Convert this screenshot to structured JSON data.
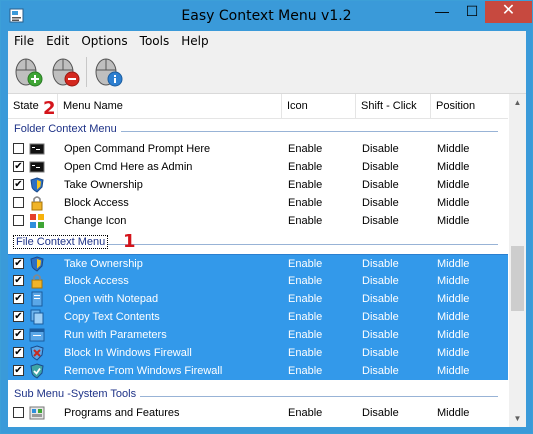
{
  "window": {
    "title": "Easy Context Menu v1.2",
    "minimize_glyph": "—",
    "maximize_glyph": "☐",
    "close_glyph": "✕",
    "accent_color": "#3a9ad9"
  },
  "menubar": {
    "items": [
      "File",
      "Edit",
      "Options",
      "Tools",
      "Help"
    ]
  },
  "toolbar": {
    "buttons": [
      {
        "icon": "mouse-add-icon"
      },
      {
        "icon": "mouse-remove-icon"
      },
      {
        "icon": "mouse-info-icon"
      }
    ]
  },
  "columns": {
    "state": "State",
    "menu_name": "Menu Name",
    "icon": "Icon",
    "shift": "Shift - Click",
    "position": "Position"
  },
  "groups": {
    "folder": "Folder Context Menu",
    "file": "File Context Menu",
    "submenu": "Sub Menu -System Tools"
  },
  "folder_rows": [
    {
      "checked": false,
      "icon": "console-icon",
      "name": "Open Command Prompt Here",
      "icon_state": "Enable",
      "shift": "Disable",
      "position": "Middle"
    },
    {
      "checked": true,
      "icon": "console-icon",
      "name": "Open Cmd Here as Admin",
      "icon_state": "Enable",
      "shift": "Disable",
      "position": "Middle"
    },
    {
      "checked": true,
      "icon": "shield-icon",
      "name": "Take Ownership",
      "icon_state": "Enable",
      "shift": "Disable",
      "position": "Middle"
    },
    {
      "checked": false,
      "icon": "lock-icon",
      "name": "Block Access",
      "icon_state": "Enable",
      "shift": "Disable",
      "position": "Middle"
    },
    {
      "checked": false,
      "icon": "change-icon-icon",
      "name": "Change Icon",
      "icon_state": "Enable",
      "shift": "Disable",
      "position": "Middle"
    }
  ],
  "file_rows": [
    {
      "checked": true,
      "icon": "shield-icon",
      "name": "Take Ownership",
      "icon_state": "Enable",
      "shift": "Disable",
      "position": "Middle"
    },
    {
      "checked": true,
      "icon": "lock-icon",
      "name": "Block Access",
      "icon_state": "Enable",
      "shift": "Disable",
      "position": "Middle"
    },
    {
      "checked": true,
      "icon": "notepad-icon",
      "name": "Open with Notepad",
      "icon_state": "Enable",
      "shift": "Disable",
      "position": "Middle"
    },
    {
      "checked": true,
      "icon": "copy-icon",
      "name": "Copy Text Contents",
      "icon_state": "Enable",
      "shift": "Disable",
      "position": "Middle"
    },
    {
      "checked": true,
      "icon": "run-icon",
      "name": "Run with Parameters",
      "icon_state": "Enable",
      "shift": "Disable",
      "position": "Middle"
    },
    {
      "checked": true,
      "icon": "firewall-block-icon",
      "name": "Block In Windows Firewall",
      "icon_state": "Enable",
      "shift": "Disable",
      "position": "Middle"
    },
    {
      "checked": true,
      "icon": "firewall-remove-icon",
      "name": "Remove From Windows Firewall",
      "icon_state": "Enable",
      "shift": "Disable",
      "position": "Middle"
    }
  ],
  "submenu_rows": [
    {
      "checked": false,
      "icon": "programs-icon",
      "name": "Programs and Features",
      "icon_state": "Enable",
      "shift": "Disable",
      "position": "Middle"
    }
  ],
  "annotations": {
    "one": "1",
    "two": "2"
  },
  "colors": {
    "selection": "#3399ea",
    "group_label": "#1e3287",
    "annotation": "#d4141b"
  }
}
